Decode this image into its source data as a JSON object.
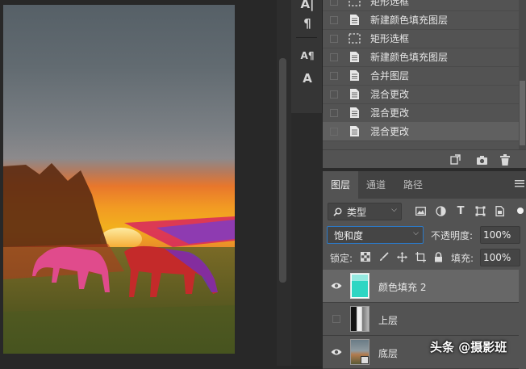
{
  "history": {
    "steps": [
      {
        "label": "矩形选框",
        "icon": "marquee-icon"
      },
      {
        "label": "新建颜色填充图层",
        "icon": "document-icon"
      },
      {
        "label": "矩形选框",
        "icon": "marquee-icon"
      },
      {
        "label": "新建颜色填充图层",
        "icon": "document-icon"
      },
      {
        "label": "合并图层",
        "icon": "document-icon"
      },
      {
        "label": "混合更改",
        "icon": "document-icon"
      },
      {
        "label": "混合更改",
        "icon": "document-icon"
      },
      {
        "label": "混合更改",
        "icon": "document-icon"
      }
    ],
    "active_index": 7
  },
  "layers_panel": {
    "tabs": [
      "图层",
      "通道",
      "路径"
    ],
    "active_tab": "图层",
    "filter_kind": "类型",
    "blend_mode": "饱和度",
    "opacity_label": "不透明度:",
    "opacity_value": "100%",
    "lock_label": "锁定:",
    "fill_label": "填充:",
    "fill_value": "100%",
    "layers": [
      {
        "name": "颜色填充 2",
        "visible": true,
        "selected": true,
        "thumb_color": "#2ed6c3"
      },
      {
        "name": "上层",
        "visible": false,
        "selected": false
      },
      {
        "name": "底层",
        "visible": true,
        "selected": false
      }
    ]
  },
  "tools": [
    "A|",
    "¶",
    "A¶",
    "A"
  ],
  "watermark": "头条 @摄影班"
}
